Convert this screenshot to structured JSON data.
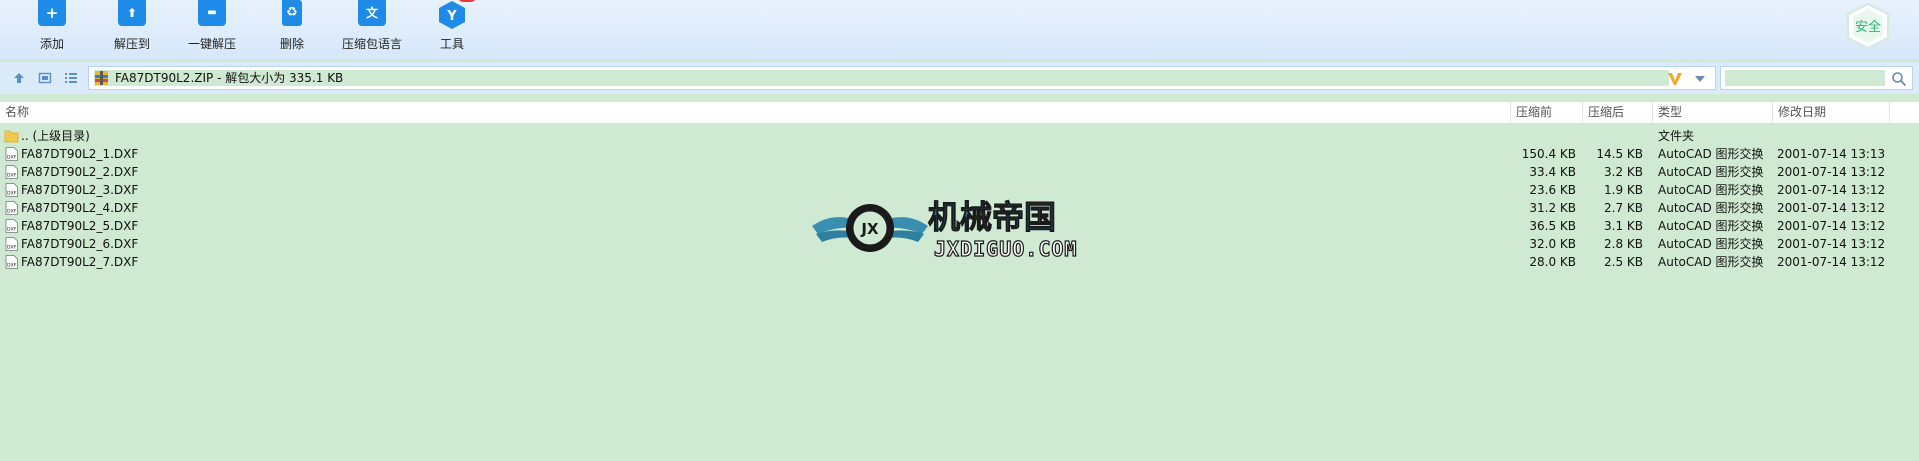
{
  "toolbar": {
    "buttons": [
      {
        "label": "添加",
        "glyph": "+",
        "icon": "add-folder-icon"
      },
      {
        "label": "解压到",
        "glyph": "⬆",
        "icon": "extract-to-icon"
      },
      {
        "label": "一键解压",
        "glyph": "▬",
        "icon": "quick-extract-icon"
      },
      {
        "label": "删除",
        "glyph": "♻",
        "icon": "delete-icon"
      },
      {
        "label": "压缩包语言",
        "glyph": "文",
        "icon": "archive-language-icon"
      },
      {
        "label": "工具",
        "glyph": "Y",
        "icon": "tools-icon"
      }
    ],
    "safe_label": "安全"
  },
  "address": {
    "path_text": "FA87DT90L2.ZIP - 解包大小为 335.1 KB"
  },
  "columns": {
    "name": "名称",
    "packed": "压缩前",
    "unpacked": "压缩后",
    "type": "类型",
    "modified": "修改日期"
  },
  "rows": [
    {
      "name": ".. (上级目录)",
      "packed": "",
      "unpacked": "",
      "type": "文件夹",
      "modified": "",
      "kind": "folder"
    },
    {
      "name": "FA87DT90L2_1.DXF",
      "packed": "150.4 KB",
      "unpacked": "14.5 KB",
      "type": "AutoCAD 图形交换",
      "modified": "2001-07-14 13:13",
      "kind": "dxf"
    },
    {
      "name": "FA87DT90L2_2.DXF",
      "packed": "33.4 KB",
      "unpacked": "3.2 KB",
      "type": "AutoCAD 图形交换",
      "modified": "2001-07-14 13:12",
      "kind": "dxf"
    },
    {
      "name": "FA87DT90L2_3.DXF",
      "packed": "23.6 KB",
      "unpacked": "1.9 KB",
      "type": "AutoCAD 图形交换",
      "modified": "2001-07-14 13:12",
      "kind": "dxf"
    },
    {
      "name": "FA87DT90L2_4.DXF",
      "packed": "31.2 KB",
      "unpacked": "2.7 KB",
      "type": "AutoCAD 图形交换",
      "modified": "2001-07-14 13:12",
      "kind": "dxf"
    },
    {
      "name": "FA87DT90L2_5.DXF",
      "packed": "36.5 KB",
      "unpacked": "3.1 KB",
      "type": "AutoCAD 图形交换",
      "modified": "2001-07-14 13:12",
      "kind": "dxf"
    },
    {
      "name": "FA87DT90L2_6.DXF",
      "packed": "32.0 KB",
      "unpacked": "2.8 KB",
      "type": "AutoCAD 图形交换",
      "modified": "2001-07-14 13:12",
      "kind": "dxf"
    },
    {
      "name": "FA87DT90L2_7.DXF",
      "packed": "28.0 KB",
      "unpacked": "2.5 KB",
      "type": "AutoCAD 图形交换",
      "modified": "2001-07-14 13:12",
      "kind": "dxf"
    }
  ],
  "watermark": {
    "cn_text": "机械帝国",
    "en_text": "JXDIGUO.COM",
    "emblem_text": "JX"
  },
  "colors": {
    "accent": "#1e8be8",
    "selection_bg": "#cfe9d2",
    "badge": "#e53935",
    "safe_green": "#2bb673"
  }
}
